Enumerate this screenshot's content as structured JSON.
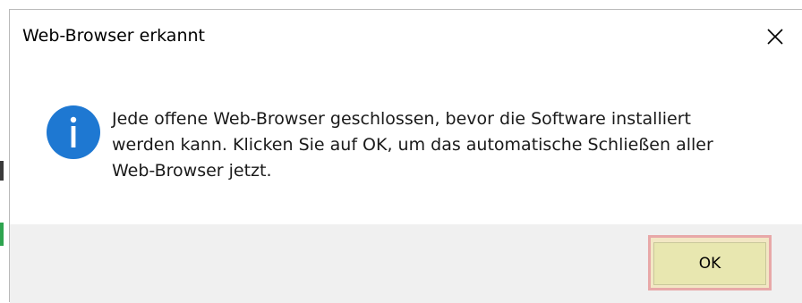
{
  "dialog": {
    "title": "Web-Browser erkannt",
    "close_icon": "close-icon",
    "info_icon": "info-icon",
    "message_lines": [
      "Jede offene Web-Browser geschlossen, bevor die Software installiert",
      "werden kann. Klicken Sie auf OK, um das automatische Schließen aller",
      "Web-Browser jetzt."
    ],
    "ok_label": "OK"
  },
  "colors": {
    "info_blue": "#1e78d2",
    "ok_button_bg": "#e8e7b0",
    "ok_highlight_border": "#e8a8a8",
    "footer_bg": "#f0f0f0"
  }
}
